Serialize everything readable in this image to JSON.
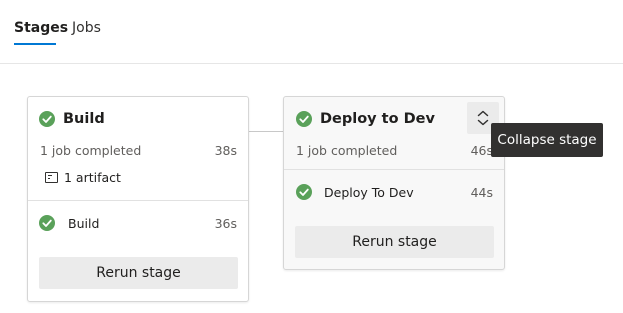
{
  "tabs": [
    {
      "label": "Stages",
      "active": true
    },
    {
      "label": "Jobs",
      "active": false
    }
  ],
  "stages": [
    {
      "title": "Build",
      "jobs_completed": "1 job completed",
      "duration": "38s",
      "artifact": "1 artifact",
      "job": {
        "name": "Build",
        "duration": "36s"
      },
      "rerun_label": "Rerun stage"
    },
    {
      "title": "Deploy to Dev",
      "jobs_completed": "1 job completed",
      "duration": "46s",
      "job": {
        "name": "Deploy To Dev",
        "duration": "44s"
      },
      "rerun_label": "Rerun stage"
    }
  ],
  "tooltip": "Collapse stage",
  "colors": {
    "accent": "#0078d4",
    "success": "#5aa15a",
    "tooltip_bg": "#323130",
    "button_bg": "#ebebeb"
  },
  "icons": {
    "success": "check-circle-icon",
    "artifact": "artifact-icon",
    "collapse": "collapse-chevrons-icon"
  }
}
